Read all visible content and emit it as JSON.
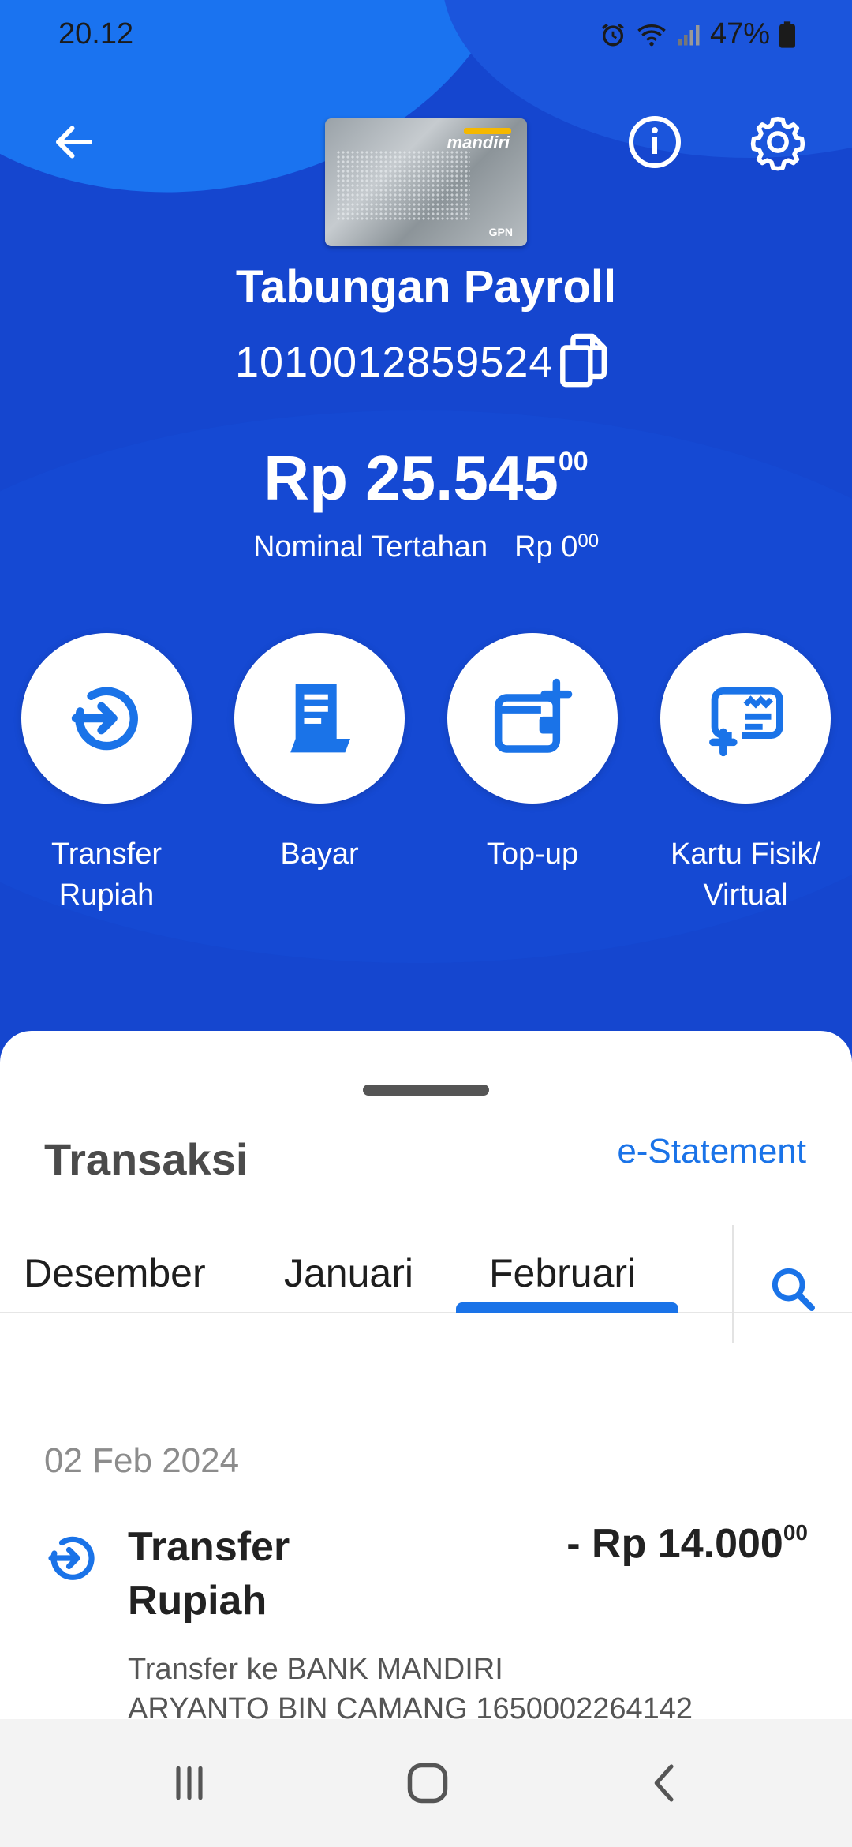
{
  "status_bar": {
    "time": "20.12",
    "battery": "47%"
  },
  "header": {
    "card_brand": "mandiri",
    "card_network": "GPN",
    "account_title": "Tabungan Payroll",
    "account_number": "1010012859524",
    "balance_main": "Rp 25.545",
    "balance_cents": "00",
    "held_label": "Nominal Tertahan",
    "held_amount": "Rp 0",
    "held_cents": "00"
  },
  "actions": [
    {
      "label_line1": "Transfer",
      "label_line2": "Rupiah",
      "icon": "transfer-icon"
    },
    {
      "label_line1": "Bayar",
      "label_line2": "",
      "icon": "bill-icon"
    },
    {
      "label_line1": "Top-up",
      "label_line2": "",
      "icon": "wallet-plus-icon"
    },
    {
      "label_line1": "Kartu Fisik/",
      "label_line2": "Virtual",
      "icon": "card-add-icon"
    }
  ],
  "transactions": {
    "title": "Transaksi",
    "estatement_label": "e-Statement",
    "tabs": [
      "Desember",
      "Januari",
      "Februari"
    ],
    "active_tab": "Februari",
    "groups": [
      {
        "date": "02 Feb 2024",
        "items": [
          {
            "name_line1": "Transfer",
            "name_line2": "Rupiah",
            "amount": "- Rp 14.000",
            "amount_cents": "00",
            "desc_line1": "Transfer ke BANK MANDIRI",
            "desc_line2": "ARYANTO BIN CAMANG 1650002264142"
          }
        ]
      }
    ]
  },
  "colors": {
    "primary": "#1546cf",
    "accent": "#1a73e8"
  }
}
